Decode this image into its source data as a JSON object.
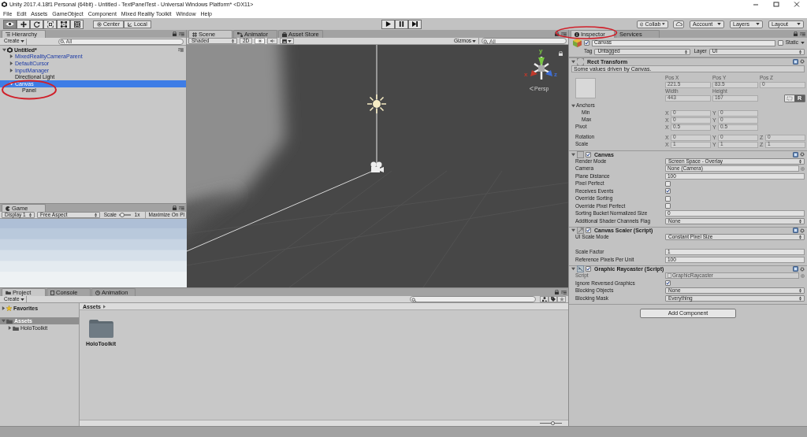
{
  "window": {
    "title": "Unity 2017.4.18f1 Personal (64bit) - Untitled - TextPanelTest - Universal Windows Platform* <DX11>"
  },
  "menu": [
    "File",
    "Edit",
    "Assets",
    "GameObject",
    "Component",
    "Mixed Reality Toolkit",
    "Window",
    "Help"
  ],
  "toolbar": {
    "tools": [
      {
        "kind": "view",
        "selected": true
      },
      {
        "kind": "move",
        "selected": false
      },
      {
        "kind": "rotate",
        "selected": false
      },
      {
        "kind": "scale",
        "selected": false
      },
      {
        "kind": "rect",
        "selected": false
      },
      {
        "kind": "transform",
        "selected": false
      }
    ],
    "pivot": [
      "Center",
      "Local"
    ],
    "playback": [
      {
        "kind": "play"
      },
      {
        "kind": "pause"
      },
      {
        "kind": "step"
      }
    ],
    "collab": "Collab",
    "account": "Account",
    "layers": "Layers",
    "layout": "Layout"
  },
  "hierarchy": {
    "tab": "Hierarchy",
    "create": "Create",
    "search_placeholder": "All",
    "tree": [
      {
        "label": "Untitled*",
        "kind": "scene",
        "expanded": true,
        "selected": false,
        "children": [
          {
            "label": "MixedRealityCameraParent",
            "kind": "prefab",
            "expanded": false,
            "selected": false
          },
          {
            "label": "DefaultCursor",
            "kind": "prefab",
            "expanded": false,
            "selected": false
          },
          {
            "label": "InputManager",
            "kind": "prefab",
            "expanded": false,
            "selected": false
          },
          {
            "label": "Directional Light",
            "kind": "object",
            "selected": false
          },
          {
            "label": "Canvas",
            "kind": "object",
            "expanded": true,
            "selected": true,
            "children": [
              {
                "label": "Panel",
                "kind": "object",
                "selected": false
              }
            ]
          }
        ]
      }
    ]
  },
  "game": {
    "tab": "Game",
    "display": "Display 1",
    "aspect": "Free Aspect",
    "scale_label": "Scale",
    "scale_slider": {
      "level": 0.1
    },
    "scale_value": "1x",
    "maximize": "Maximize On Pl"
  },
  "scene": {
    "tabs": [
      {
        "label": "Scene",
        "kind": "scene",
        "selected": true
      },
      {
        "label": "Animator",
        "kind": "animator",
        "selected": false
      },
      {
        "label": "Asset Store",
        "kind": "store",
        "selected": false
      }
    ],
    "shading": "Shaded",
    "mode_2d": "2D",
    "lighting_on": true,
    "audio_on": false,
    "gizmos": "Gizmos",
    "search_placeholder": "All",
    "projection": "Persp",
    "axes": [
      {
        "label": "y",
        "color": "#7ac943"
      },
      {
        "label": "x",
        "color": "#c0392b"
      },
      {
        "label": "z",
        "color": "#3f6fd8"
      }
    ]
  },
  "inspector": {
    "tabs": [
      {
        "label": "Inspector",
        "kind": "inspector",
        "selected": true
      },
      {
        "label": "Services",
        "kind": "services",
        "selected": false
      }
    ],
    "object": {
      "active": true,
      "name": "Canvas",
      "static_label": "Static",
      "static": false,
      "tag_label": "Tag",
      "tag": "Untagged",
      "layer_label": "Layer",
      "layer": "UI"
    },
    "rect_transform": {
      "title": "Rect Transform",
      "note": "Some values driven by Canvas.",
      "position": [
        {
          "label": "Pos X",
          "value": "221.5"
        },
        {
          "label": "Pos Y",
          "value": "83.5"
        },
        {
          "label": "Pos Z",
          "value": "0"
        }
      ],
      "size": [
        {
          "label": "Width",
          "value": "443"
        },
        {
          "label": "Height",
          "value": "167"
        }
      ],
      "raw_button": "R",
      "anchors": {
        "label": "Anchors",
        "expanded": true,
        "rows": [
          {
            "label": "Min",
            "fields": [
              {
                "axis": "X",
                "value": "0"
              },
              {
                "axis": "Y",
                "value": "0"
              }
            ]
          },
          {
            "label": "Max",
            "fields": [
              {
                "axis": "X",
                "value": "0"
              },
              {
                "axis": "Y",
                "value": "0"
              }
            ]
          }
        ]
      },
      "pivot": {
        "label": "Pivot",
        "fields": [
          {
            "axis": "X",
            "value": "0.5"
          },
          {
            "axis": "Y",
            "value": "0.5"
          }
        ]
      },
      "rows": [
        {
          "label": "Rotation",
          "fields": [
            {
              "axis": "X",
              "value": "0"
            },
            {
              "axis": "Y",
              "value": "0"
            },
            {
              "axis": "Z",
              "value": "0"
            }
          ]
        },
        {
          "label": "Scale",
          "fields": [
            {
              "axis": "X",
              "value": "1"
            },
            {
              "axis": "Y",
              "value": "1"
            },
            {
              "axis": "Z",
              "value": "1"
            }
          ]
        }
      ]
    },
    "components": [
      {
        "title": "Canvas",
        "kind": "canvas",
        "enabled": true,
        "rows": [
          {
            "label": "Render Mode",
            "kind": "dropdown",
            "value": "Screen Space - Overlay"
          },
          {
            "label": "Camera",
            "kind": "object",
            "value": "None (Camera)"
          },
          {
            "label": "Plane Distance",
            "kind": "text",
            "value": "100"
          },
          {
            "label": "Pixel Perfect",
            "kind": "checkbox",
            "checked": false
          },
          {
            "label": "Receives Events",
            "kind": "checkbox",
            "checked": true
          },
          {
            "label": "Override Sorting",
            "kind": "checkbox",
            "checked": false
          },
          {
            "label": "Override Pixel Perfect",
            "kind": "checkbox",
            "checked": false
          },
          {
            "label": "Sorting Bucket Normalized Size",
            "kind": "text",
            "value": "0"
          },
          {
            "label": "Additional Shader Channels Flag",
            "kind": "dropdown",
            "value": "None"
          }
        ]
      },
      {
        "title": "Canvas Scaler (Script)",
        "kind": "scaler",
        "enabled": true,
        "rows": [
          {
            "label": "UI Scale Mode",
            "kind": "dropdown",
            "value": "Constant Pixel Size"
          },
          {
            "kind": "spacer"
          },
          {
            "label": "Scale Factor",
            "kind": "text",
            "value": "1"
          },
          {
            "label": "Reference Pixels Per Unit",
            "kind": "text",
            "value": "100"
          }
        ]
      },
      {
        "title": "Graphic Raycaster (Script)",
        "kind": "raycaster",
        "enabled": true,
        "rows": [
          {
            "label": "Script",
            "kind": "script",
            "value": "GraphicRaycaster"
          },
          {
            "label": "Ignore Reversed Graphics",
            "kind": "checkbox",
            "checked": true
          },
          {
            "label": "Blocking Objects",
            "kind": "dropdown",
            "value": "None"
          },
          {
            "label": "Blocking Mask",
            "kind": "dropdown",
            "value": "Everything"
          }
        ]
      }
    ],
    "add_component": "Add Component"
  },
  "project": {
    "tabs": [
      {
        "label": "Project",
        "kind": "project",
        "selected": true
      },
      {
        "label": "Console",
        "kind": "console",
        "selected": false
      },
      {
        "label": "Animation",
        "kind": "animation",
        "selected": false
      }
    ],
    "create": "Create",
    "sidebar": [
      {
        "label": "Favorites",
        "kind": "favorites",
        "expanded": false,
        "selected": false
      },
      {
        "label": "Assets",
        "kind": "folder",
        "expanded": true,
        "selected": true,
        "children": [
          {
            "label": "HoloToolkit",
            "kind": "folder",
            "expanded": false,
            "selected": false
          }
        ]
      }
    ],
    "breadcrumb": "Assets",
    "assets": [
      {
        "name": "HoloToolkit"
      }
    ],
    "zoom_slider": {
      "level": 0.6
    }
  }
}
